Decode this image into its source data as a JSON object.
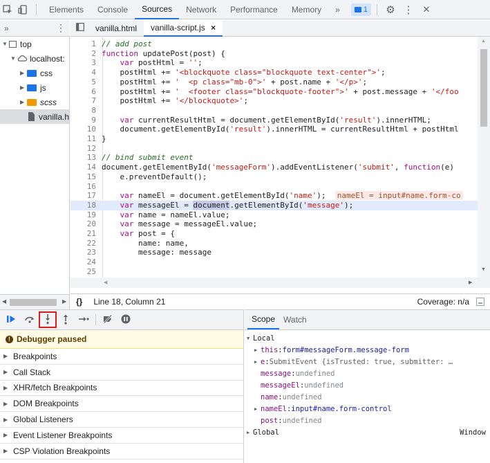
{
  "toolbar": {
    "tabs": [
      "Elements",
      "Console",
      "Sources",
      "Network",
      "Performance",
      "Memory"
    ],
    "active_tab": "Sources",
    "more": "»",
    "badge_count": "1",
    "settings": "⚙",
    "kebab": "⋮",
    "close": "✕"
  },
  "navigator": {
    "more": "»",
    "kebab": "⋮",
    "items": [
      {
        "label": "top"
      },
      {
        "label": "localhost:"
      },
      {
        "label": "css"
      },
      {
        "label": "js"
      },
      {
        "label": "scss"
      },
      {
        "label": "vanilla.h"
      }
    ]
  },
  "editor": {
    "tabs": [
      {
        "label": "vanilla.html"
      },
      {
        "label": "vanilla-script.js"
      }
    ],
    "tab_close": "×",
    "highlighted_line": 18,
    "lines": [
      {
        "n": "1",
        "parts": [
          {
            "t": "// add post",
            "c": "com"
          }
        ]
      },
      {
        "n": "2",
        "parts": [
          {
            "t": "function",
            "c": "kw"
          },
          {
            "t": " updatePost(post) {",
            "c": ""
          }
        ]
      },
      {
        "n": "3",
        "parts": [
          {
            "t": "    ",
            "c": ""
          },
          {
            "t": "var",
            "c": "kw"
          },
          {
            "t": " postHtml = ",
            "c": ""
          },
          {
            "t": "''",
            "c": "str"
          },
          {
            "t": ";",
            "c": ""
          }
        ]
      },
      {
        "n": "4",
        "parts": [
          {
            "t": "    postHtml += ",
            "c": ""
          },
          {
            "t": "'<blockquote class=\"blockquote text-center\">'",
            "c": "str"
          },
          {
            "t": ";",
            "c": ""
          }
        ]
      },
      {
        "n": "5",
        "parts": [
          {
            "t": "    postHtml += ",
            "c": ""
          },
          {
            "t": "'  <p class=\"mb-0\">'",
            "c": "str"
          },
          {
            "t": " + post.name + ",
            "c": ""
          },
          {
            "t": "'</p>'",
            "c": "str"
          },
          {
            "t": ";",
            "c": ""
          }
        ]
      },
      {
        "n": "6",
        "parts": [
          {
            "t": "    postHtml += ",
            "c": ""
          },
          {
            "t": "'  <footer class=\"blockquote-footer\">'",
            "c": "str"
          },
          {
            "t": " + post.message + ",
            "c": ""
          },
          {
            "t": "'</foo",
            "c": "str"
          }
        ]
      },
      {
        "n": "7",
        "parts": [
          {
            "t": "    postHtml += ",
            "c": ""
          },
          {
            "t": "'</blockquote>'",
            "c": "str"
          },
          {
            "t": ";",
            "c": ""
          }
        ]
      },
      {
        "n": "8",
        "parts": []
      },
      {
        "n": "9",
        "parts": [
          {
            "t": "    ",
            "c": ""
          },
          {
            "t": "var",
            "c": "kw"
          },
          {
            "t": " currentResultHtml = document.getElementById(",
            "c": ""
          },
          {
            "t": "'result'",
            "c": "str"
          },
          {
            "t": ").innerHTML;",
            "c": ""
          }
        ]
      },
      {
        "n": "10",
        "parts": [
          {
            "t": "    document.getElementById(",
            "c": ""
          },
          {
            "t": "'result'",
            "c": "str"
          },
          {
            "t": ").innerHTML = currentResultHtml + postHtml",
            "c": ""
          }
        ]
      },
      {
        "n": "11",
        "parts": [
          {
            "t": "}",
            "c": ""
          }
        ]
      },
      {
        "n": "12",
        "parts": []
      },
      {
        "n": "13",
        "parts": [
          {
            "t": "// bind submit event",
            "c": "com"
          }
        ]
      },
      {
        "n": "14",
        "parts": [
          {
            "t": "document.getElementById(",
            "c": ""
          },
          {
            "t": "'messageForm'",
            "c": "str"
          },
          {
            "t": ").addEventListener(",
            "c": ""
          },
          {
            "t": "'submit'",
            "c": "str"
          },
          {
            "t": ", ",
            "c": ""
          },
          {
            "t": "function",
            "c": "kw"
          },
          {
            "t": "(e)",
            "c": ""
          }
        ]
      },
      {
        "n": "15",
        "parts": [
          {
            "t": "    e.preventDefault();",
            "c": ""
          }
        ]
      },
      {
        "n": "16",
        "parts": []
      },
      {
        "n": "17",
        "parts": [
          {
            "t": "    ",
            "c": ""
          },
          {
            "t": "var",
            "c": "kw"
          },
          {
            "t": " nameEl = document.getElementById(",
            "c": ""
          },
          {
            "t": "'name'",
            "c": "str"
          },
          {
            "t": ");  ",
            "c": ""
          },
          {
            "t": "nameEl = input#name.form-co",
            "c": "inline"
          }
        ]
      },
      {
        "n": "18",
        "parts": [
          {
            "t": "    ",
            "c": ""
          },
          {
            "t": "var",
            "c": "kw"
          },
          {
            "t": " messageEl = ",
            "c": ""
          },
          {
            "t": "document",
            "c": "sel"
          },
          {
            "t": ".getElementById(",
            "c": ""
          },
          {
            "t": "'message'",
            "c": "str"
          },
          {
            "t": ");",
            "c": ""
          }
        ]
      },
      {
        "n": "19",
        "parts": [
          {
            "t": "    ",
            "c": ""
          },
          {
            "t": "var",
            "c": "kw"
          },
          {
            "t": " name = nameEl.value;",
            "c": ""
          }
        ]
      },
      {
        "n": "20",
        "parts": [
          {
            "t": "    ",
            "c": ""
          },
          {
            "t": "var",
            "c": "kw"
          },
          {
            "t": " message = messageEl.value;",
            "c": ""
          }
        ]
      },
      {
        "n": "21",
        "parts": [
          {
            "t": "    ",
            "c": ""
          },
          {
            "t": "var",
            "c": "kw"
          },
          {
            "t": " post = {",
            "c": ""
          }
        ]
      },
      {
        "n": "22",
        "parts": [
          {
            "t": "        name: name,",
            "c": ""
          }
        ]
      },
      {
        "n": "23",
        "parts": [
          {
            "t": "        message: message",
            "c": ""
          }
        ]
      },
      {
        "n": "24",
        "parts": []
      },
      {
        "n": "25",
        "parts": []
      }
    ]
  },
  "status": {
    "braces": "{}",
    "position": "Line 18, Column 21",
    "coverage": "Coverage: n/a"
  },
  "debugger": {
    "paused": "Debugger paused",
    "panes": [
      "Breakpoints",
      "Call Stack",
      "XHR/fetch Breakpoints",
      "DOM Breakpoints",
      "Global Listeners",
      "Event Listener Breakpoints",
      "CSP Violation Breakpoints"
    ]
  },
  "scope": {
    "tabs": [
      "Scope",
      "Watch"
    ],
    "local_label": "Local",
    "rows": [
      {
        "key": "this",
        "value": "form#messageForm.message-form",
        "expandable": true
      },
      {
        "key": "e",
        "value": "SubmitEvent {isTrusted: true, submitter: …",
        "expandable": true
      },
      {
        "key": "message",
        "value": "undefined",
        "expandable": false
      },
      {
        "key": "messageEl",
        "value": "undefined",
        "expandable": false
      },
      {
        "key": "name",
        "value": "undefined",
        "expandable": false
      },
      {
        "key": "nameEl",
        "value": "input#name.form-control",
        "expandable": true
      },
      {
        "key": "post",
        "value": "undefined",
        "expandable": false
      }
    ],
    "global_label": "Global",
    "global_value": "Window"
  }
}
